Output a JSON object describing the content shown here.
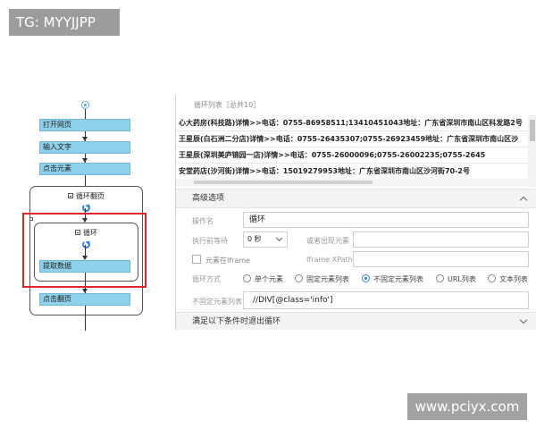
{
  "watermarks": {
    "top_left": "TG: MYYJJPP",
    "bottom_right": "www.pciyx.com"
  },
  "workflow": {
    "steps": [
      "打开网页",
      "输入文字",
      "点击元素"
    ],
    "outer_loop_title": "循环翻页",
    "inner_loop_title": "循环",
    "extract_step": "提取数据",
    "next_page_step": "点击翻页"
  },
  "panel": {
    "list_header": "循环列表［总共10］",
    "list_rows": [
      "心大药房(科技路)详情>>电话：0755-86958511;13410451043地址：广东省深圳市南山区科发路2号",
      "王星辰(白石洲二分店)详情>>电话：0755-26435307;0755-26923459地址：广东省深圳市南山区沙",
      "王星辰(深圳美庐锦园一店)详情>>电话：0755-26000096;0755-26002235;0755-2645",
      "安堂药店(沙河街)详情>>电话：15019279953地址：广东省深圳市南山区沙河街70-2号"
    ],
    "advanced_title": "高级选项",
    "op_name_label": "操作名",
    "op_name_value": "循环",
    "wait_label": "执行前等待",
    "wait_value": "0 秒",
    "or_appear_label": "或者出现元素",
    "iframe_label": "元素在Iframe",
    "iframe_xpath_label": "Iframe XPath",
    "loop_mode_label": "循环方式",
    "loop_modes": [
      "单个元素",
      "固定元素列表",
      "不固定元素列表",
      "URL列表",
      "文本列表"
    ],
    "loop_mode_selected": "不固定元素列表",
    "unfixed_list_label": "不固定元素列表",
    "xpath_value": "//DIV[@class='info']",
    "exit_condition": "满足以下条件时退出循环"
  }
}
